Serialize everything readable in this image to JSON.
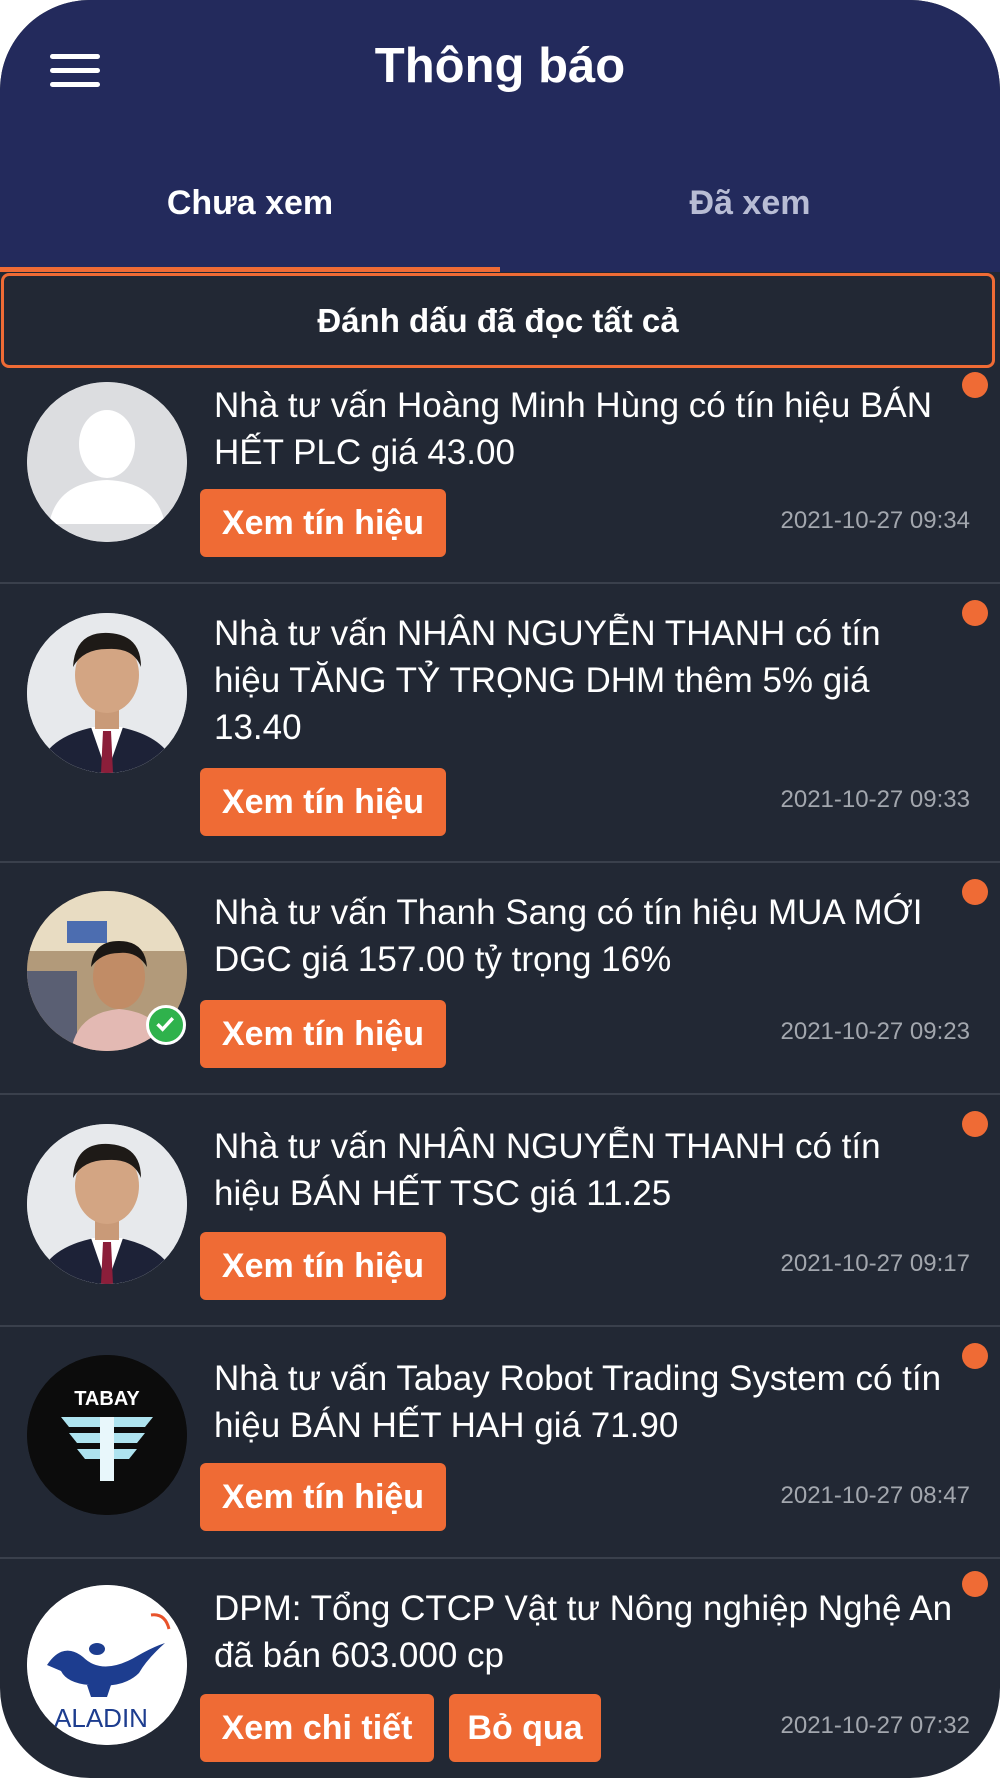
{
  "header": {
    "title": "Thông báo"
  },
  "tabs": [
    {
      "label": "Chưa xem",
      "active": true
    },
    {
      "label": "Đã xem",
      "active": false
    }
  ],
  "mark_all_label": "Đánh dấu đã đọc tất cả",
  "colors": {
    "header": "#232a5c",
    "background": "#222834",
    "accent": "#ef6b35"
  },
  "notifications": [
    {
      "text": "Nhà tư vấn Hoàng Minh Hùng có tín hiệu BÁN HẾT PLC giá 43.00",
      "button": "Xem tín hiệu",
      "time": "2021-10-27 09:34",
      "avatar": "default-user-avatar",
      "unread": true
    },
    {
      "text": "Nhà tư vấn NHÂN NGUYỄN THANH có tín hiệu TĂNG TỶ TRỌNG DHM thêm 5% giá 13.40",
      "button": "Xem tín hiệu",
      "time": "2021-10-27 09:33",
      "avatar": "advisor-photo",
      "unread": true
    },
    {
      "text": "Nhà tư vấn Thanh Sang có tín hiệu MUA MỚI DGC giá 157.00 tỷ trọng 16%",
      "button": "Xem tín hiệu",
      "time": "2021-10-27 09:23",
      "avatar": "advisor-photo-verified",
      "unread": true
    },
    {
      "text": "Nhà tư vấn NHÂN NGUYỄN THANH có tín hiệu BÁN HẾT TSC giá 11.25",
      "button": "Xem tín hiệu",
      "time": "2021-10-27 09:17",
      "avatar": "advisor-photo",
      "unread": true
    },
    {
      "text": "Nhà tư vấn Tabay Robot Trading System có tín hiệu BÁN HẾT HAH giá 71.90",
      "button": "Xem tín hiệu",
      "time": "2021-10-27 08:47",
      "avatar": "tabay-logo",
      "logo_text": "TABAY",
      "unread": true
    },
    {
      "text": "DPM: Tổng CTCP Vật tư Nông nghiệp Nghệ An đã bán 603.000 cp",
      "button": "Xem chi tiết",
      "button2": "Bỏ qua",
      "time": "2021-10-27 07:32",
      "avatar": "aladin-logo",
      "logo_text": "ALADIN",
      "unread": true
    }
  ]
}
